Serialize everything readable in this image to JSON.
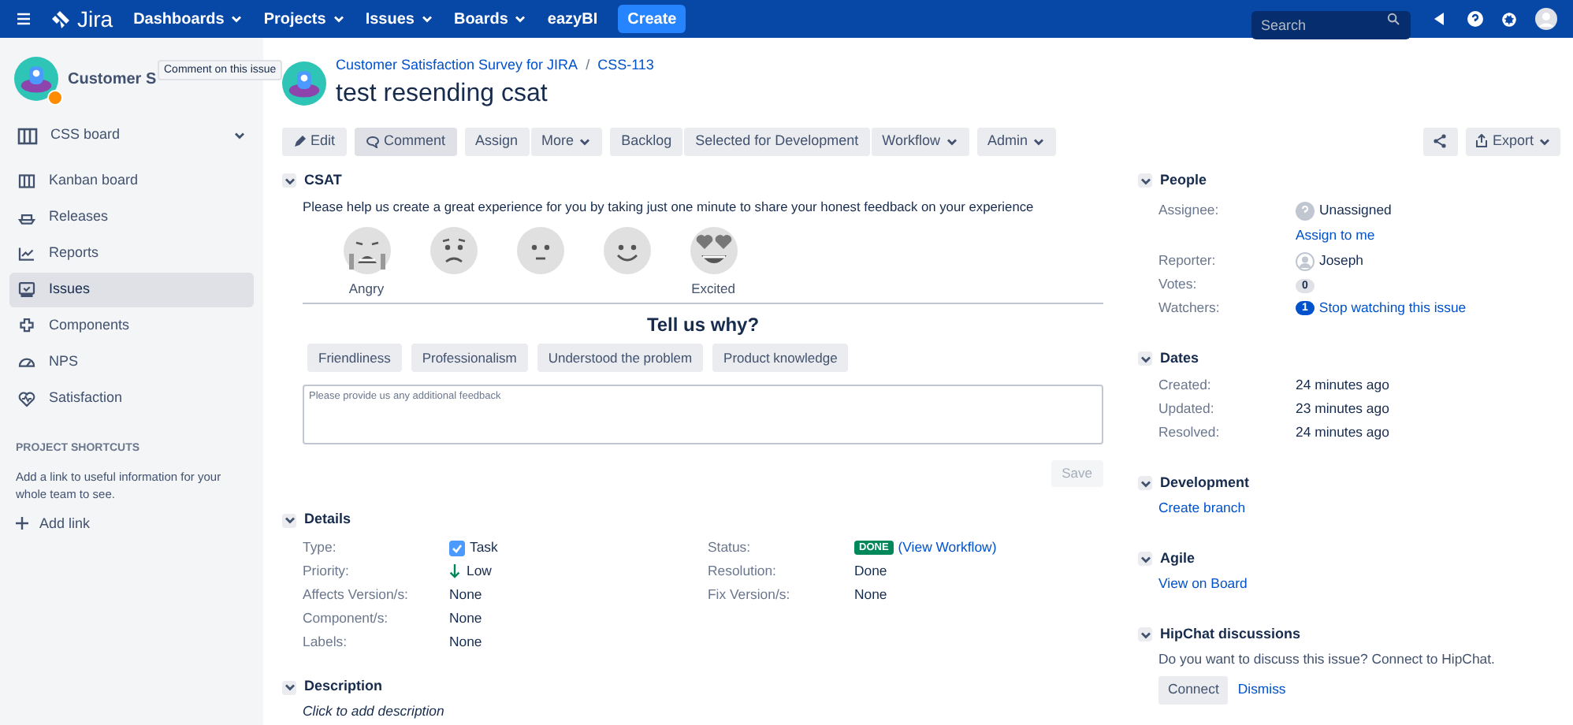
{
  "nav": {
    "items": [
      {
        "label": "Dashboards",
        "dropdown": true
      },
      {
        "label": "Projects",
        "dropdown": true
      },
      {
        "label": "Issues",
        "dropdown": true
      },
      {
        "label": "Boards",
        "dropdown": true
      },
      {
        "label": "eazyBI",
        "dropdown": false
      }
    ],
    "logo": "Jira",
    "create": "Create",
    "search_placeholder": "Search"
  },
  "sidebar": {
    "project_name": "Customer S",
    "tooltip": "Comment on this issue",
    "board": "CSS board",
    "items": [
      {
        "label": "Kanban board",
        "selected": false
      },
      {
        "label": "Releases",
        "selected": false
      },
      {
        "label": "Reports",
        "selected": false
      },
      {
        "label": "Issues",
        "selected": true
      },
      {
        "label": "Components",
        "selected": false
      },
      {
        "label": "NPS",
        "selected": false
      },
      {
        "label": "Satisfaction",
        "selected": false
      }
    ],
    "shortcuts_heading": "PROJECT SHORTCUTS",
    "shortcuts_text": "Add a link to useful information for your whole team to see.",
    "add_link": "Add link"
  },
  "issue": {
    "project": "Customer Satisfaction Survey for JIRA",
    "separator": "/",
    "key": "CSS-113",
    "title": "test resending csat",
    "toolbar": [
      [
        {
          "label": "Edit",
          "kind": "edit",
          "dropdown": false
        }
      ],
      [
        {
          "label": "Comment",
          "kind": "comment",
          "dropdown": false
        }
      ],
      [
        {
          "label": "Assign",
          "kind": "plain",
          "dropdown": false
        },
        {
          "label": "More",
          "kind": "plain",
          "dropdown": true
        }
      ],
      [
        {
          "label": "Backlog",
          "kind": "plain",
          "dropdown": false
        },
        {
          "label": "Selected for Development",
          "kind": "plain",
          "dropdown": false
        },
        {
          "label": "Workflow",
          "kind": "plain",
          "dropdown": true
        }
      ],
      [
        {
          "label": "Admin",
          "kind": "plain",
          "dropdown": true
        }
      ]
    ],
    "export": "Export"
  },
  "csat": {
    "title": "CSAT",
    "prompt": "Please help us create a great experience for you by taking just one minute to share your honest feedback on your experience",
    "faces": [
      {
        "kind": "crying",
        "label": "Angry"
      },
      {
        "kind": "sad"
      },
      {
        "kind": "neutral"
      },
      {
        "kind": "smile"
      },
      {
        "kind": "hearts",
        "label": "Excited"
      }
    ],
    "question": "Tell us why?",
    "reasons": [
      "Friendliness",
      "Professionalism",
      "Understood the problem",
      "Product knowledge"
    ],
    "feedback_placeholder": "Please provide us any additional feedback",
    "save": "Save",
    "save_disabled": true
  },
  "details": {
    "title": "Details",
    "left": [
      {
        "label": "Type:",
        "value": "Task",
        "kind": "type"
      },
      {
        "label": "Priority:",
        "value": "Low",
        "kind": "priority"
      },
      {
        "label": "Affects Version/s:",
        "value": "None",
        "kind": "text"
      },
      {
        "label": "Component/s:",
        "value": "None",
        "kind": "text"
      },
      {
        "label": "Labels:",
        "value": "None",
        "kind": "text"
      }
    ],
    "right": [
      {
        "label": "Status:",
        "value": "DONE",
        "link": "(View Workflow)",
        "kind": "status"
      },
      {
        "label": "Resolution:",
        "value": "Done",
        "kind": "text"
      },
      {
        "label": "Fix Version/s:",
        "value": "None",
        "kind": "text"
      }
    ]
  },
  "description": {
    "title": "Description",
    "placeholder": "Click to add description"
  },
  "people": {
    "title": "People",
    "rows": [
      {
        "label": "Assignee:",
        "value": "Unassigned",
        "kind": "unknown-user",
        "link": "Assign to me"
      },
      {
        "label": "Reporter:",
        "value": "Joseph",
        "kind": "user"
      },
      {
        "label": "Votes:",
        "value": "0",
        "kind": "count"
      },
      {
        "label": "Watchers:",
        "value": "1",
        "kind": "watch",
        "link": "Stop watching this issue"
      }
    ]
  },
  "dates": {
    "title": "Dates",
    "rows": [
      {
        "label": "Created:",
        "value": "24 minutes ago"
      },
      {
        "label": "Updated:",
        "value": "23 minutes ago"
      },
      {
        "label": "Resolved:",
        "value": "24 minutes ago"
      }
    ]
  },
  "development": {
    "title": "Development",
    "link": "Create branch"
  },
  "agile": {
    "title": "Agile",
    "link": "View on Board"
  },
  "hipchat": {
    "title": "HipChat discussions",
    "text": "Do you want to discuss this issue? Connect to HipChat.",
    "connect": "Connect",
    "dismiss": "Dismiss"
  }
}
